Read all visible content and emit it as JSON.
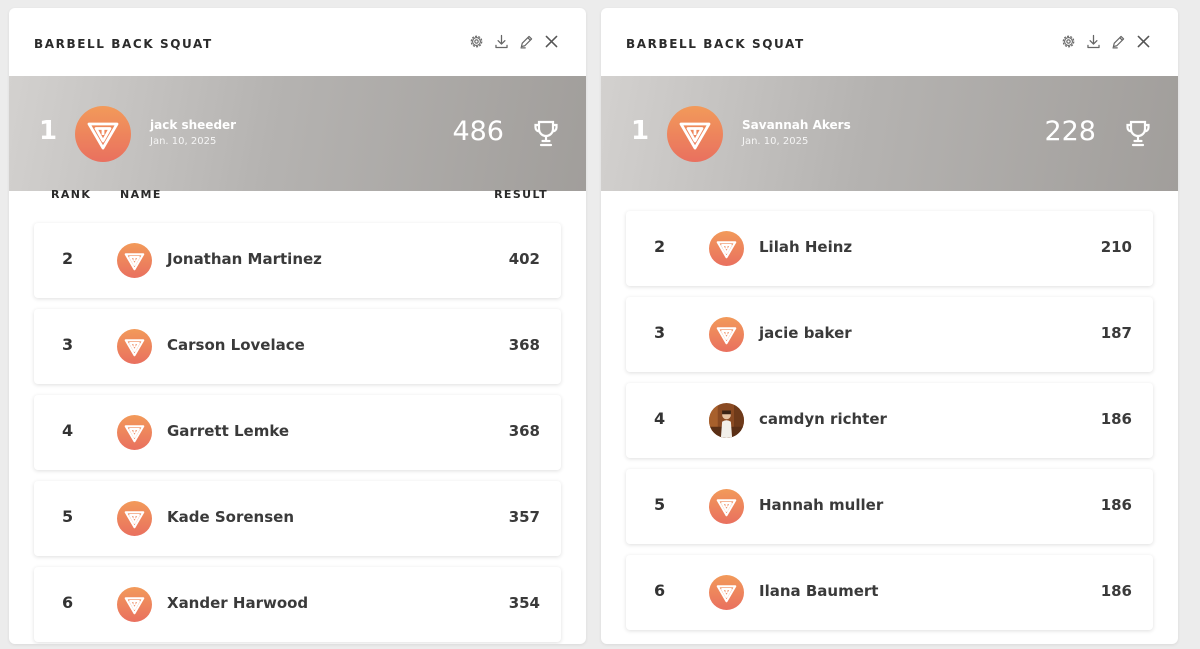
{
  "colors": {
    "accent_top": "#f29a5a",
    "accent_bottom": "#e9705f",
    "leader_bg_start": "#d3d1cf",
    "leader_bg_end": "#a19e9b"
  },
  "header_icons": [
    "gear-icon",
    "download-icon",
    "pencil-icon",
    "close-icon"
  ],
  "left": {
    "title": "BARBELL BACK SQUAT",
    "leader": {
      "rank": "1",
      "name": "jack sheeder",
      "date": "Jan. 10, 2025",
      "score": "486"
    },
    "columns": {
      "rank": "RANK",
      "name": "NAME",
      "result": "RESULT"
    },
    "rows": [
      {
        "rank": "2",
        "name": "Jonathan Martinez",
        "value": "402",
        "avatar": "logo"
      },
      {
        "rank": "3",
        "name": "Carson Lovelace",
        "value": "368",
        "avatar": "logo"
      },
      {
        "rank": "4",
        "name": "Garrett Lemke",
        "value": "368",
        "avatar": "logo"
      },
      {
        "rank": "5",
        "name": "Kade Sorensen",
        "value": "357",
        "avatar": "logo"
      },
      {
        "rank": "6",
        "name": "Xander Harwood",
        "value": "354",
        "avatar": "logo"
      }
    ]
  },
  "right": {
    "title": "BARBELL BACK SQUAT",
    "leader": {
      "rank": "1",
      "name": "Savannah Akers",
      "date": "Jan. 10, 2025",
      "score": "228"
    },
    "rows": [
      {
        "rank": "2",
        "name": "Lilah Heinz",
        "value": "210",
        "avatar": "logo"
      },
      {
        "rank": "3",
        "name": "jacie baker",
        "value": "187",
        "avatar": "logo"
      },
      {
        "rank": "4",
        "name": "camdyn richter",
        "value": "186",
        "avatar": "photo"
      },
      {
        "rank": "5",
        "name": "Hannah muller",
        "value": "186",
        "avatar": "logo"
      },
      {
        "rank": "6",
        "name": "Ilana Baumert",
        "value": "186",
        "avatar": "logo"
      }
    ]
  }
}
